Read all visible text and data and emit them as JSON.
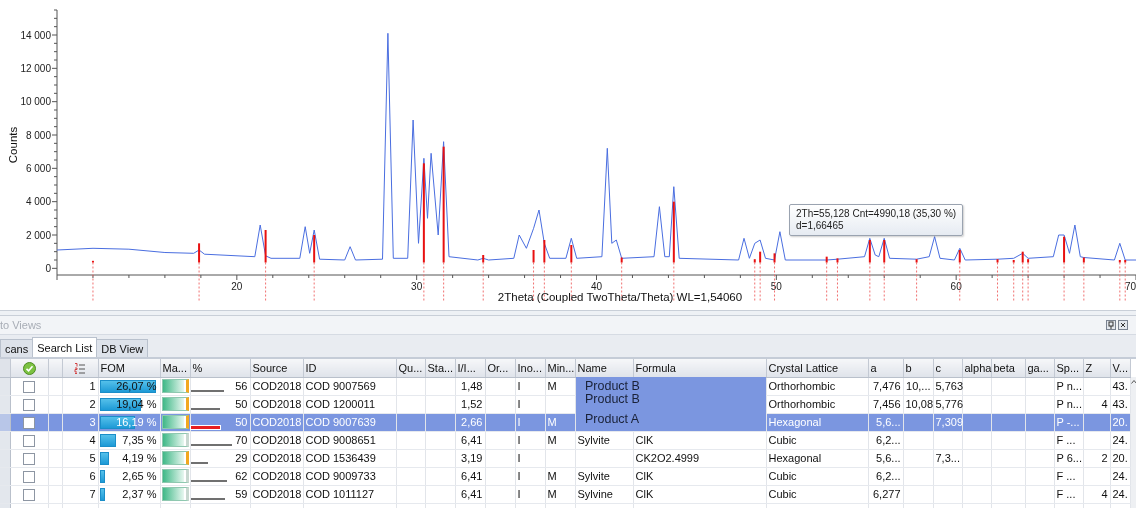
{
  "chart": {
    "chart_data": {
      "type": "line",
      "xlabel": "2Theta (Coupled TwoTheta/Theta) WL=1,54060",
      "ylabel": "Counts",
      "x": [
        10,
        12,
        14,
        16,
        17.6,
        17.9,
        18.2,
        21,
        21.3,
        21.6,
        21.9,
        23.5,
        23.8,
        24.05,
        24.3,
        24.6,
        26,
        26.3,
        26.6,
        28.1,
        28.4,
        28.7,
        29.5,
        29.8,
        30.1,
        30.4,
        30.6,
        30.8,
        31.2,
        31.5,
        31.8,
        33.4,
        33.7,
        34,
        35.4,
        35.7,
        36.1,
        36.5,
        36.8,
        37.1,
        37.4,
        38.3,
        38.6,
        38.9,
        40.3,
        40.6,
        40.85,
        41.1,
        41.4,
        43.2,
        43.5,
        43.8,
        44.05,
        44.3,
        44.6,
        47.9,
        48.2,
        48.5,
        48.8,
        49.1,
        49.4,
        49.9,
        50.2,
        50.5,
        52.8,
        53.4,
        54.9,
        55.2,
        55.5,
        55.7,
        56,
        56.3,
        57.8,
        58.5,
        58.8,
        59.1,
        59.9,
        60.2,
        60.5,
        62.3,
        63.2,
        63.7,
        64,
        65.4,
        65.7,
        66,
        66.3,
        66.6,
        66.9,
        67.1,
        68.8,
        69.1,
        69.4,
        70
      ],
      "series": [
        {
          "color": "#4a6ee0",
          "values": [
            1100,
            1200,
            1150,
            950,
            900,
            1100,
            850,
            700,
            2600,
            750,
            600,
            600,
            2500,
            900,
            2300,
            550,
            500,
            1300,
            500,
            550,
            14100,
            600,
            600,
            8900,
            1500,
            6600,
            3000,
            6900,
            2000,
            7600,
            700,
            500,
            600,
            500,
            600,
            2000,
            1200,
            2400,
            3500,
            1500,
            600,
            600,
            1800,
            600,
            700,
            7200,
            1500,
            1700,
            600,
            700,
            3700,
            700,
            700,
            4900,
            600,
            500,
            1800,
            600,
            1500,
            1700,
            600,
            500,
            2200,
            500,
            500,
            550,
            700,
            1800,
            800,
            700,
            1800,
            600,
            550,
            700,
            1900,
            600,
            500,
            1200,
            500,
            550,
            600,
            900,
            600,
            700,
            2000,
            2000,
            900,
            2600,
            700,
            650,
            500,
            1500,
            500,
            500
          ]
        }
      ],
      "xlim": [
        10,
        70
      ],
      "ylim": [
        -400,
        15500
      ],
      "xticks": [
        20,
        30,
        40,
        50,
        60,
        70
      ],
      "yticks": [
        {
          "value": 0,
          "label": "0"
        },
        {
          "value": 2000,
          "label": "2 000"
        },
        {
          "value": 4000,
          "label": "4 000"
        },
        {
          "value": 6000,
          "label": "6 000"
        },
        {
          "value": 8000,
          "label": "8 000"
        },
        {
          "value": 10000,
          "label": "10 000"
        },
        {
          "value": 12000,
          "label": "12 000"
        },
        {
          "value": 14000,
          "label": "14 000"
        }
      ]
    },
    "tooltip": {
      "lines": [
        "2Th=55,128 Cnt=4990,18 (35,30 %)",
        "d=1,66465"
      ]
    }
  },
  "panel": {
    "title": "to Views"
  },
  "tabs": [
    {
      "label": "cans",
      "selected": false
    },
    {
      "label": "Search List",
      "selected": true
    },
    {
      "label": "DB View",
      "selected": false
    }
  ],
  "table": {
    "columns": [
      {
        "kind": "check"
      },
      {
        "kind": "blank"
      },
      {
        "kind": "index"
      },
      {
        "kind": "fom",
        "label": "FOM"
      },
      {
        "kind": "match",
        "label": "Ma..."
      },
      {
        "kind": "percent",
        "label": "%"
      },
      {
        "kind": "text",
        "label": "Source"
      },
      {
        "kind": "text",
        "label": "ID"
      },
      {
        "kind": "text",
        "label": "Qu..."
      },
      {
        "kind": "text",
        "label": "Sta..."
      },
      {
        "kind": "number",
        "label": "I/I..."
      },
      {
        "kind": "text",
        "label": "Or..."
      },
      {
        "kind": "text",
        "label": "Ino..."
      },
      {
        "kind": "text",
        "label": "Min..."
      },
      {
        "kind": "text",
        "label": "Name"
      },
      {
        "kind": "text",
        "label": "Formula"
      },
      {
        "kind": "text",
        "label": "Crystal Lattice"
      },
      {
        "kind": "number",
        "label": "a"
      },
      {
        "kind": "number",
        "label": "b"
      },
      {
        "kind": "number",
        "label": "c"
      },
      {
        "kind": "text",
        "label": "alpha"
      },
      {
        "kind": "text",
        "label": "beta"
      },
      {
        "kind": "text",
        "label": "ga..."
      },
      {
        "kind": "text",
        "label": "Sp..."
      },
      {
        "kind": "number",
        "label": "Z"
      },
      {
        "kind": "text",
        "label": "V..."
      }
    ],
    "rows": [
      {
        "selected": false,
        "cells": [
          {
            "checked": false
          },
          null,
          "1",
          {
            "text": "26,07 %",
            "level": 0.97
          },
          {
            "level": 0.92,
            "flagged": true
          },
          {
            "text": "56",
            "level": 0.56
          },
          "COD2018",
          "COD 9007569",
          null,
          null,
          "1,48",
          null,
          "I",
          "M",
          null,
          null,
          "Orthorhombic",
          "7,476",
          "10,...",
          "5,763",
          null,
          null,
          null,
          "P n...",
          null,
          "43."
        ]
      },
      {
        "selected": false,
        "cells": [
          {
            "checked": false
          },
          null,
          "2",
          {
            "text": "19,04 %",
            "level": 0.72
          },
          {
            "level": 0.92,
            "flagged": true
          },
          {
            "text": "50",
            "level": 0.5
          },
          "COD2018",
          "COD 1200011",
          null,
          null,
          "1,52",
          null,
          "I",
          null,
          null,
          null,
          "Orthorhombic",
          "7,456",
          "10,08",
          "5,776",
          null,
          null,
          null,
          "P n...",
          "4",
          "43."
        ]
      },
      {
        "selected": true,
        "cells": [
          {
            "checked": false
          },
          null,
          "3",
          {
            "text": "16,19 %",
            "level": 0.62
          },
          {
            "level": 0.92,
            "flagged": true
          },
          {
            "text": "50",
            "level": 0.5
          },
          "COD2018",
          "COD 9007639",
          null,
          null,
          "2,66",
          null,
          "I",
          "M",
          null,
          null,
          "Hexagonal",
          "5,6...",
          null,
          "7,309",
          null,
          null,
          null,
          "P -...",
          null,
          "20."
        ]
      },
      {
        "selected": false,
        "cells": [
          {
            "checked": false
          },
          null,
          "4",
          {
            "text": "7,35 %",
            "level": 0.28
          },
          {
            "level": 0.95,
            "flagged": false
          },
          {
            "text": "70",
            "level": 0.7
          },
          "COD2018",
          "COD 9008651",
          null,
          null,
          "6,41",
          null,
          "I",
          "M",
          "Sylvite",
          "ClK",
          "Cubic",
          "6,2...",
          null,
          null,
          null,
          null,
          null,
          "F ...",
          null,
          "24."
        ]
      },
      {
        "selected": false,
        "cells": [
          {
            "checked": false
          },
          null,
          "5",
          {
            "text": "4,19 %",
            "level": 0.16
          },
          {
            "level": 0.92,
            "flagged": true
          },
          {
            "text": "29",
            "level": 0.29
          },
          "COD2018",
          "COD 1536439",
          null,
          null,
          "3,19",
          null,
          "I",
          null,
          null,
          "CK2O2.4999",
          "Hexagonal",
          "5,6...",
          null,
          "7,3...",
          null,
          null,
          null,
          "P 6...",
          "2",
          "20."
        ]
      },
      {
        "selected": false,
        "cells": [
          {
            "checked": false
          },
          null,
          "6",
          {
            "text": "2,65 %",
            "level": 0.1
          },
          {
            "level": 0.95,
            "flagged": false
          },
          {
            "text": "62",
            "level": 0.62
          },
          "COD2018",
          "COD 9009733",
          null,
          null,
          "6,41",
          null,
          "I",
          "M",
          "Sylvite",
          "ClK",
          "Cubic",
          "6,2...",
          null,
          null,
          null,
          null,
          null,
          "F ...",
          null,
          "24."
        ]
      },
      {
        "selected": false,
        "cells": [
          {
            "checked": false
          },
          null,
          "7",
          {
            "text": "2,37 %",
            "level": 0.09
          },
          {
            "level": 0.95,
            "flagged": false
          },
          {
            "text": "59",
            "level": 0.59
          },
          "COD2018",
          "COD 1011127",
          null,
          null,
          "6,41",
          null,
          "I",
          "M",
          "Sylvine",
          "ClK",
          "Cubic",
          "6,277",
          null,
          null,
          null,
          null,
          null,
          "F ...",
          "4",
          "24."
        ]
      }
    ],
    "overlay_labels": [
      "Product B",
      "Product B",
      "Product A"
    ]
  }
}
